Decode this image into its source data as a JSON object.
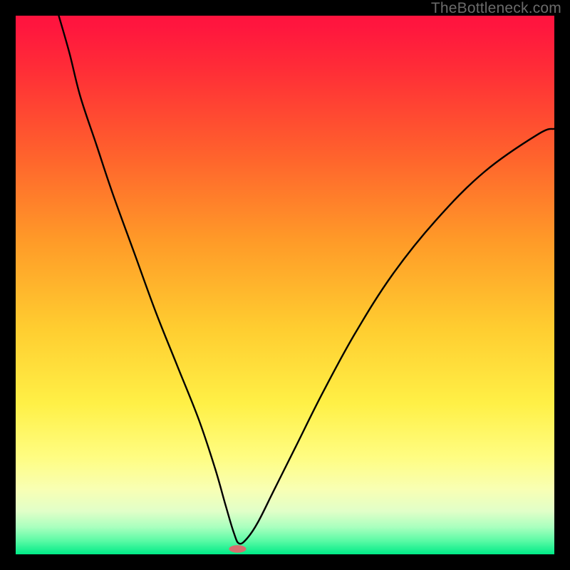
{
  "watermark_text": "TheBottleneck.com",
  "chart_data": {
    "type": "line",
    "title": "",
    "xlabel": "",
    "ylabel": "",
    "xlim": [
      0,
      100
    ],
    "ylim": [
      0,
      100
    ],
    "notes": "Bottleneck-style V-curve over vertical rainbow gradient (red top → green bottom). Curve descends from top-left to a minimum near x≈41 then rises toward upper-right. Small reddish pill marks the minimum at the bottom.",
    "series": [
      {
        "name": "curve",
        "x": [
          8,
          10,
          12,
          15,
          18,
          22,
          26,
          30,
          34,
          37,
          39,
          40.5,
          41.5,
          43,
          45,
          48,
          52,
          57,
          63,
          70,
          78,
          87,
          97,
          100
        ],
        "y": [
          100,
          93,
          85,
          76,
          67,
          56,
          45,
          35,
          25,
          16,
          9,
          4,
          2,
          3,
          6,
          12,
          20,
          30,
          41,
          52,
          62,
          71,
          78,
          79
        ]
      }
    ],
    "min_marker": {
      "x": 41.2,
      "y": 1.0,
      "rx": 1.6,
      "ry": 0.7
    }
  },
  "colors": {
    "background": "#000000",
    "curve_stroke": "#000000",
    "marker_fill": "rgb(215,110,110)"
  }
}
